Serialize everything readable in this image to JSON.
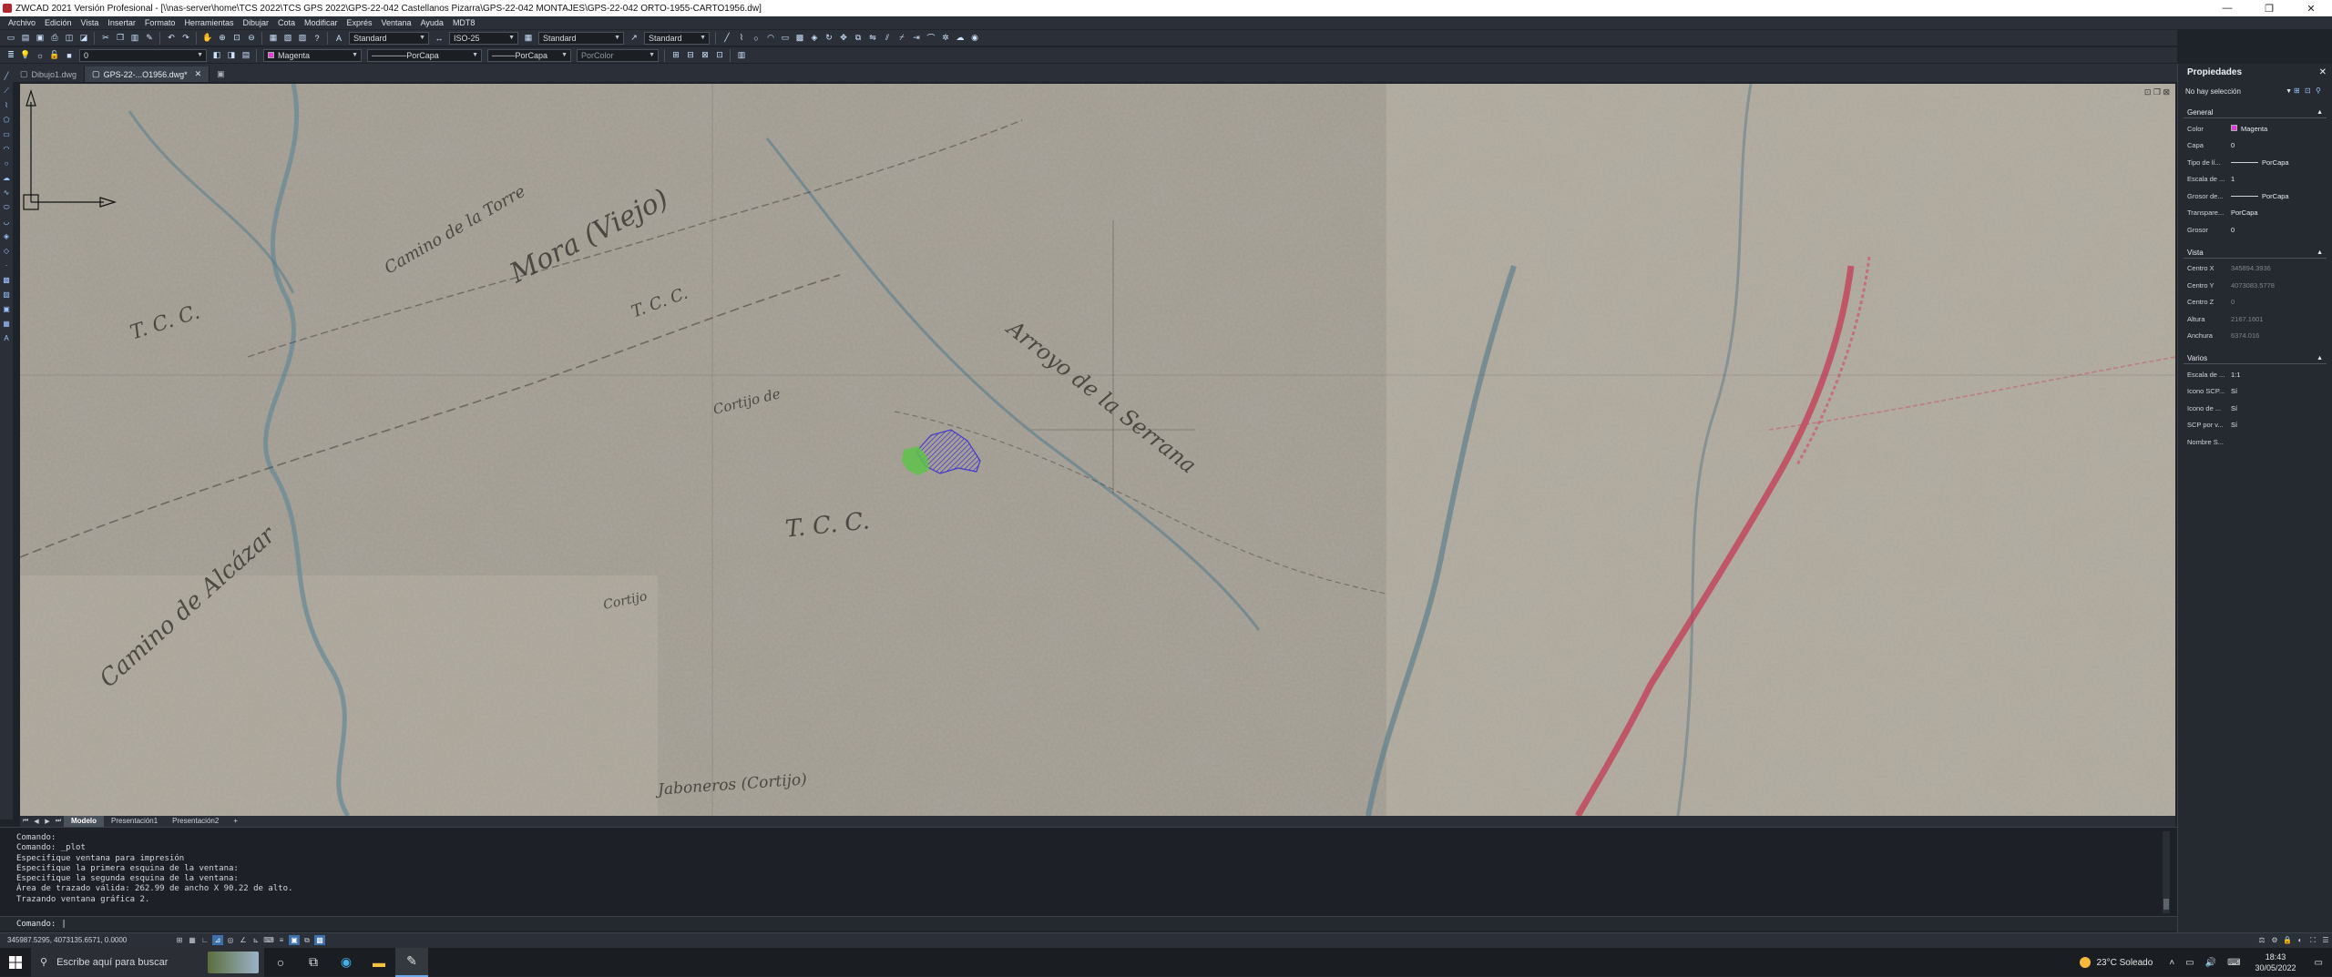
{
  "window": {
    "title": "ZWCAD 2021 Versión Profesional - [\\\\nas-server\\home\\TCS 2022\\TCS GPS 2022\\GPS-22-042 Castellanos Pizarra\\GPS-22-042 MONTAJES\\GPS-22-042 ORTO-1955-CARTO1956.dw]",
    "controls": [
      "—",
      "❐",
      "✕"
    ]
  },
  "menu": [
    "Archivo",
    "Edición",
    "Vista",
    "Insertar",
    "Formato",
    "Herramientas",
    "Dibujar",
    "Cota",
    "Modificar",
    "Exprés",
    "Ventana",
    "Ayuda",
    "MDT8"
  ],
  "toolbar1": {
    "text_style": "Standard",
    "dim_style": "ISO-25",
    "table_style": "Standard",
    "mleader_style": "Standard"
  },
  "toolbar2": {
    "layer": "0",
    "color": "Magenta",
    "color_hex": "#e13ed8",
    "linetype": "PorCapa",
    "lineweight": "PorCapa",
    "plotstyle": "PorColor"
  },
  "doc_tabs": [
    {
      "label": "Dibujo1.dwg",
      "active": false
    },
    {
      "label": "GPS-22-...O1956.dwg*",
      "active": true
    }
  ],
  "layout_tabs": [
    "Modelo",
    "Presentación1",
    "Presentación2",
    "+"
  ],
  "map_labels": {
    "l1": "Mora (Viejo)",
    "l2": "Camino de la Torre",
    "l3": "T. C. C.",
    "l4": "Camino de Alcázar",
    "l5": "Arroyo de la Serrana",
    "l6": "T. C. C.",
    "l7": "Cortijo",
    "l8": "Jaboneros (Cortijo)",
    "l9": "Cortijo de",
    "l10": "T. C. C."
  },
  "command": {
    "history": [
      "Comando:",
      "Comando: _plot",
      "Especifique ventana para impresión",
      "Especifique la primera esquina de la ventana:",
      "Especifique la segunda esquina de la ventana:",
      "Área de trazado válida: 262.99 de ancho X 90.22 de alto.",
      "Trazando ventana gráfica 2."
    ],
    "prompt": "Comando:"
  },
  "status": {
    "coords": "345987.5295, 4073135.6571, 0.0000"
  },
  "properties": {
    "title": "Propiedades",
    "selection": "No hay selección",
    "general": {
      "header": "General",
      "rows": [
        {
          "k": "Color",
          "v": "Magenta"
        },
        {
          "k": "Capa",
          "v": "0"
        },
        {
          "k": "Tipo de lí...",
          "v": "PorCapa"
        },
        {
          "k": "Escala de ...",
          "v": "1"
        },
        {
          "k": "Grosor de...",
          "v": "PorCapa"
        },
        {
          "k": "Transpare...",
          "v": "PorCapa"
        },
        {
          "k": "Grosor",
          "v": "0"
        }
      ]
    },
    "vista": {
      "header": "Vista",
      "rows": [
        {
          "k": "Centro X",
          "v": "345894.3936"
        },
        {
          "k": "Centro Y",
          "v": "4073083.5778"
        },
        {
          "k": "Centro Z",
          "v": "0"
        },
        {
          "k": "Altura",
          "v": "2167.1601"
        },
        {
          "k": "Anchura",
          "v": "6374.016"
        }
      ]
    },
    "varios": {
      "header": "Varios",
      "rows": [
        {
          "k": "Escala de ...",
          "v": "1:1"
        },
        {
          "k": "Icono SCP...",
          "v": "Sí"
        },
        {
          "k": "Icono de ...",
          "v": "Sí"
        },
        {
          "k": "SCP por v...",
          "v": "Sí"
        },
        {
          "k": "Nombre S...",
          "v": ""
        }
      ]
    }
  },
  "taskbar": {
    "search_placeholder": "Escribe aquí para buscar",
    "weather": "23°C  Soleado",
    "time": "18:43",
    "date": "30/05/2022"
  }
}
